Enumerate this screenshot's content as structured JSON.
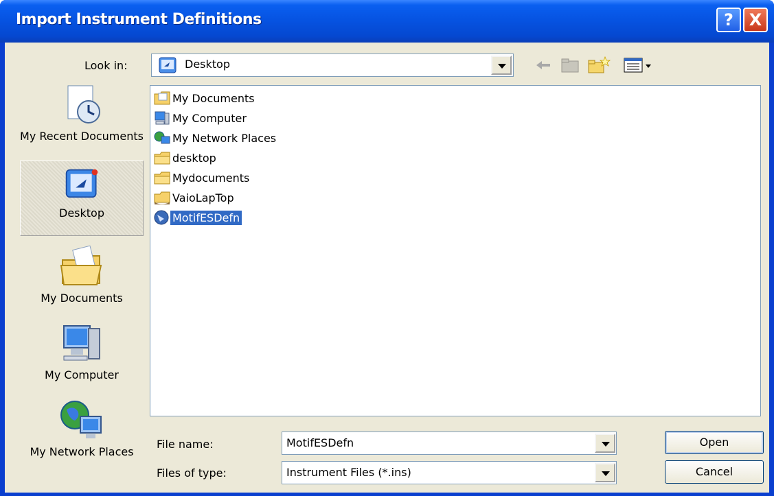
{
  "window": {
    "title": "Import Instrument Definitions",
    "help_label": "?",
    "close_label": "X"
  },
  "lookin": {
    "label": "Look in:",
    "value": "Desktop"
  },
  "places": [
    {
      "label": "My Recent Documents",
      "icon": "recent-documents-icon"
    },
    {
      "label": "Desktop",
      "icon": "desktop-icon",
      "selected": true
    },
    {
      "label": "My Documents",
      "icon": "my-documents-folder-icon"
    },
    {
      "label": "My Computer",
      "icon": "my-computer-icon"
    },
    {
      "label": "My Network Places",
      "icon": "network-places-icon"
    }
  ],
  "files": [
    {
      "name": "My Documents",
      "icon": "my-documents-icon"
    },
    {
      "name": "My Computer",
      "icon": "my-computer-icon"
    },
    {
      "name": "My Network Places",
      "icon": "network-places-icon"
    },
    {
      "name": "desktop",
      "icon": "folder-icon"
    },
    {
      "name": "Mydocuments",
      "icon": "folder-icon"
    },
    {
      "name": "VaioLapTop",
      "icon": "shared-folder-icon"
    },
    {
      "name": "MotifESDefn",
      "icon": "instrument-file-icon",
      "selected": true
    }
  ],
  "form": {
    "filename_label": "File name:",
    "filename_value": "MotifESDefn",
    "filetype_label": "Files of type:",
    "filetype_value": "Instrument Files (*.ins)",
    "open_label": "Open",
    "cancel_label": "Cancel"
  },
  "colors": {
    "titlebar": "#0652e0",
    "selection": "#316ac5",
    "dialog_bg": "#ece9d8"
  }
}
